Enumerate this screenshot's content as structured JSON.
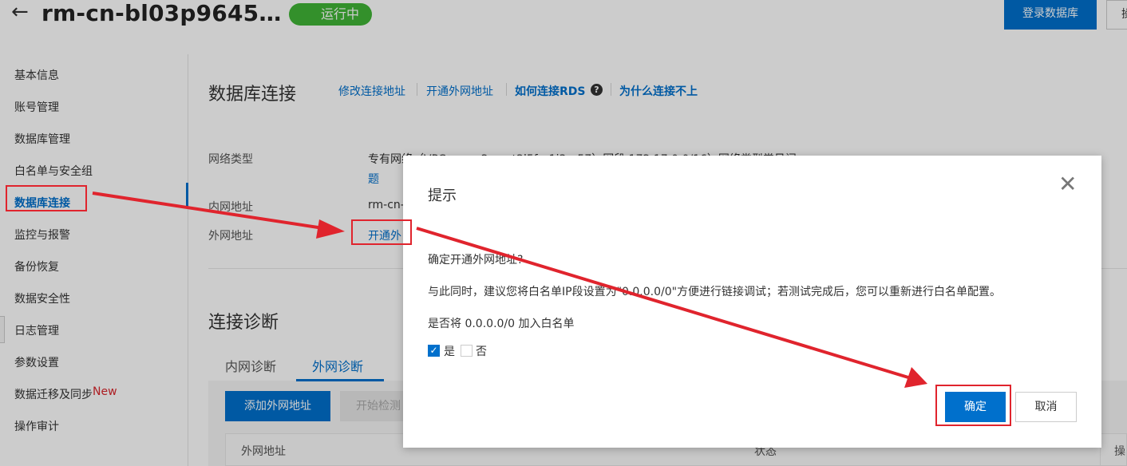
{
  "header": {
    "back_icon": "←",
    "instance_title": "rm-cn-bl03p9645…",
    "status": "运行中",
    "login_button": "登录数据库",
    "edge_button": "操"
  },
  "sidebar": {
    "items": [
      {
        "label": "基本信息"
      },
      {
        "label": "账号管理"
      },
      {
        "label": "数据库管理"
      },
      {
        "label": "白名单与安全组"
      },
      {
        "label": "数据库连接"
      },
      {
        "label": "监控与报警"
      },
      {
        "label": "备份恢复"
      },
      {
        "label": "数据安全性"
      },
      {
        "label": "日志管理"
      },
      {
        "label": "参数设置"
      },
      {
        "label": "数据迁移及同步"
      },
      {
        "label": "操作审计"
      }
    ],
    "new_tag": "New",
    "active_index": 4
  },
  "connection": {
    "title": "数据库连接",
    "links": {
      "modify": "修改连接地址",
      "open_public": "开通外网地址",
      "how_to_connect": "如何连接RDS",
      "why_fail": "为什么连接不上"
    },
    "help_icon": "?",
    "fields": {
      "network_type_label": "网络类型",
      "network_type_value": "专有网络（VPC：vpc-2ze…t2l5f…1i3…57）网段 172.17.0.0/16）网络类型常见问",
      "network_type_value_2": "题",
      "intranet_label": "内网地址",
      "intranet_value": "rm-cn-",
      "public_label": "外网地址",
      "public_value": "开通外"
    }
  },
  "diagnosis": {
    "title": "连接诊断",
    "tabs": [
      "内网诊断",
      "外网诊断"
    ],
    "active_tab": 1,
    "add_button": "添加外网地址",
    "check_button": "开始检测",
    "columns": [
      "外网地址",
      "状态",
      "操"
    ]
  },
  "dialog": {
    "title": "提示",
    "close_icon": "✕",
    "question": "确定开通外网地址?",
    "suggestion": "与此同时，建议您将白名单IP段设置为\"0.0.0.0/0\"方便进行链接调试；若测试完成后，您可以重新进行白名单配置。",
    "whitelist_question": "是否将 0.0.0.0/0 加入白名单",
    "yes_label": "是",
    "no_label": "否",
    "yes_checked": true,
    "ok_button": "确定",
    "cancel_button": "取消"
  },
  "colors": {
    "primary": "#0070cc",
    "status_green": "#40b536",
    "annotation_red": "#e0242d",
    "new_tag_red": "#d9262c"
  }
}
